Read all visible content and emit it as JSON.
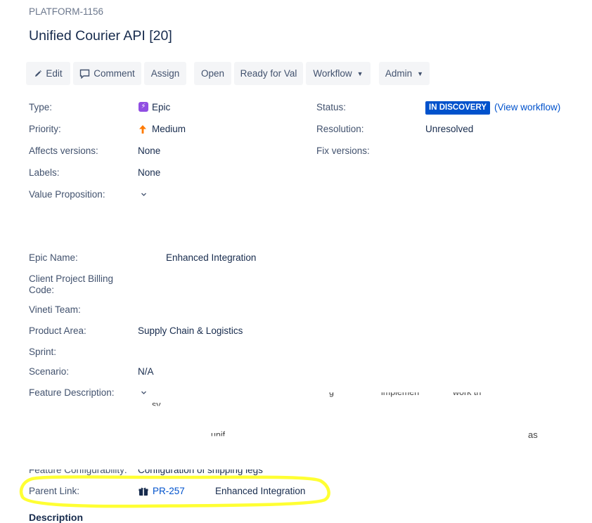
{
  "issue": {
    "key": "PLATFORM-1156",
    "title": "Unified Courier API [20]"
  },
  "toolbar": {
    "edit": "Edit",
    "comment": "Comment",
    "assign": "Assign",
    "open": "Open",
    "ready_for_val": "Ready for Val",
    "workflow": "Workflow",
    "admin": "Admin"
  },
  "details": {
    "type_label": "Type:",
    "type_value": "Epic",
    "priority_label": "Priority:",
    "priority_value": "Medium",
    "affects_label": "Affects versions:",
    "affects_value": "None",
    "labels_label": "Labels:",
    "labels_value": "None",
    "value_prop_label": "Value Proposition:",
    "status_label": "Status:",
    "status_value": "IN DISCOVERY",
    "view_workflow": "(View workflow)",
    "resolution_label": "Resolution:",
    "resolution_value": "Unresolved",
    "fix_label": "Fix versions:"
  },
  "custom_fields": {
    "epic_name_label": "Epic Name:",
    "epic_name_value": "Enhanced Integration",
    "billing_code_label_1": "Client Project Billing",
    "billing_code_label_2": "Code:",
    "vineti_team_label": "Vineti Team:",
    "product_area_label": "Product Area:",
    "product_area_value": "Supply Chain & Logistics",
    "sprint_label": "Sprint:",
    "scenario_label": "Scenario:",
    "scenario_value": "N/A",
    "feature_desc_label": "Feature Description:",
    "feature_desc_fragments": [
      "g",
      "implemen",
      "work th",
      "sy",
      "unif",
      "as"
    ],
    "feature_config_label": "Feature Configurability:",
    "feature_config_value": "Configuration of shipping legs",
    "parent_link_label": "Parent Link:",
    "parent_link_key": "PR-257",
    "parent_link_summary": "Enhanced Integration",
    "description_heading": "Description"
  },
  "colors": {
    "link": "#0052cc",
    "status_lozenge": "#0052cc",
    "epic_purple": "#904ee2",
    "priority_orange": "#ff7a00",
    "highlight": "#ffff33"
  },
  "icons": {
    "edit": "pencil-icon",
    "comment": "speech-bubble-icon",
    "type": "lightning-epic-icon",
    "priority": "arrow-up-icon",
    "parent": "gift-box-icon"
  }
}
